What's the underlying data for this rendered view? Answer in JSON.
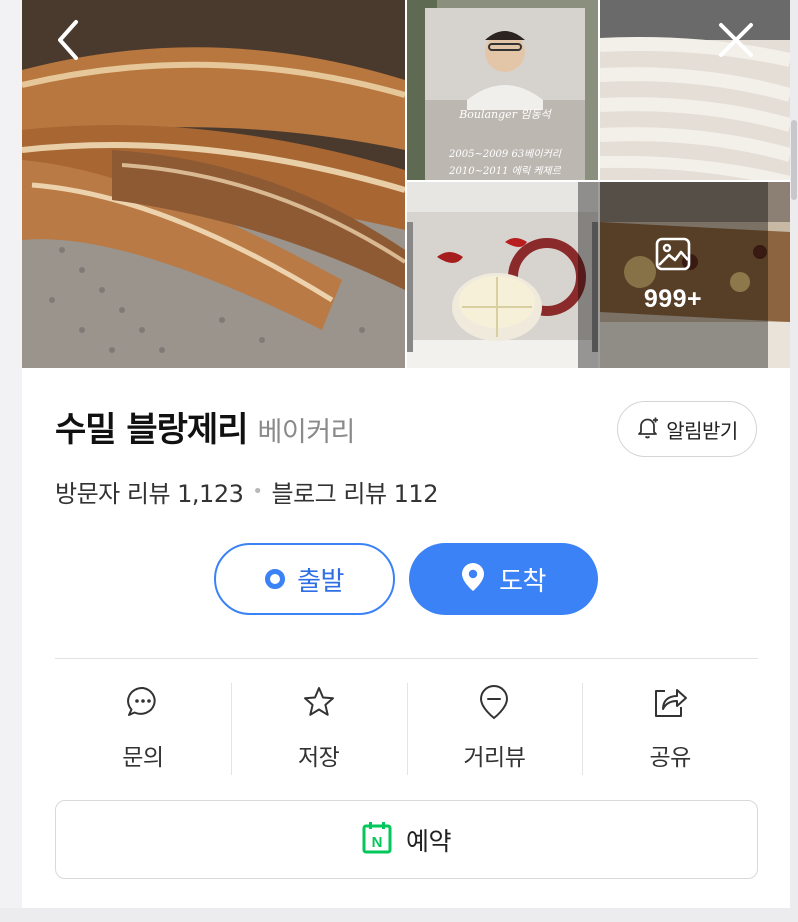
{
  "gallery": {
    "chef_photo_text": [
      "Boulanger 임동석",
      "2005~2009 63베이커리",
      "2010~2011 에릭 케제르"
    ],
    "more_count": "999+"
  },
  "place": {
    "name": "수밀 블랑제리",
    "category": "베이커리",
    "alarm_label": "알림받기"
  },
  "reviews": {
    "visitor": "방문자 리뷰 1,123",
    "blog": "블로그 리뷰 112",
    "separator": "•"
  },
  "route": {
    "start_label": "출발",
    "end_label": "도착"
  },
  "actions": [
    {
      "label": "문의",
      "icon": "chat-bubble-icon"
    },
    {
      "label": "저장",
      "icon": "star-icon"
    },
    {
      "label": "거리뷰",
      "icon": "location-pin-outline-icon"
    },
    {
      "label": "공유",
      "icon": "share-icon"
    }
  ],
  "reserve": {
    "label": "예약",
    "icon": "naver-calendar-icon",
    "icon_letter": "N"
  },
  "colors": {
    "accent": "#3b82f6",
    "naver_green": "#03c75a"
  }
}
